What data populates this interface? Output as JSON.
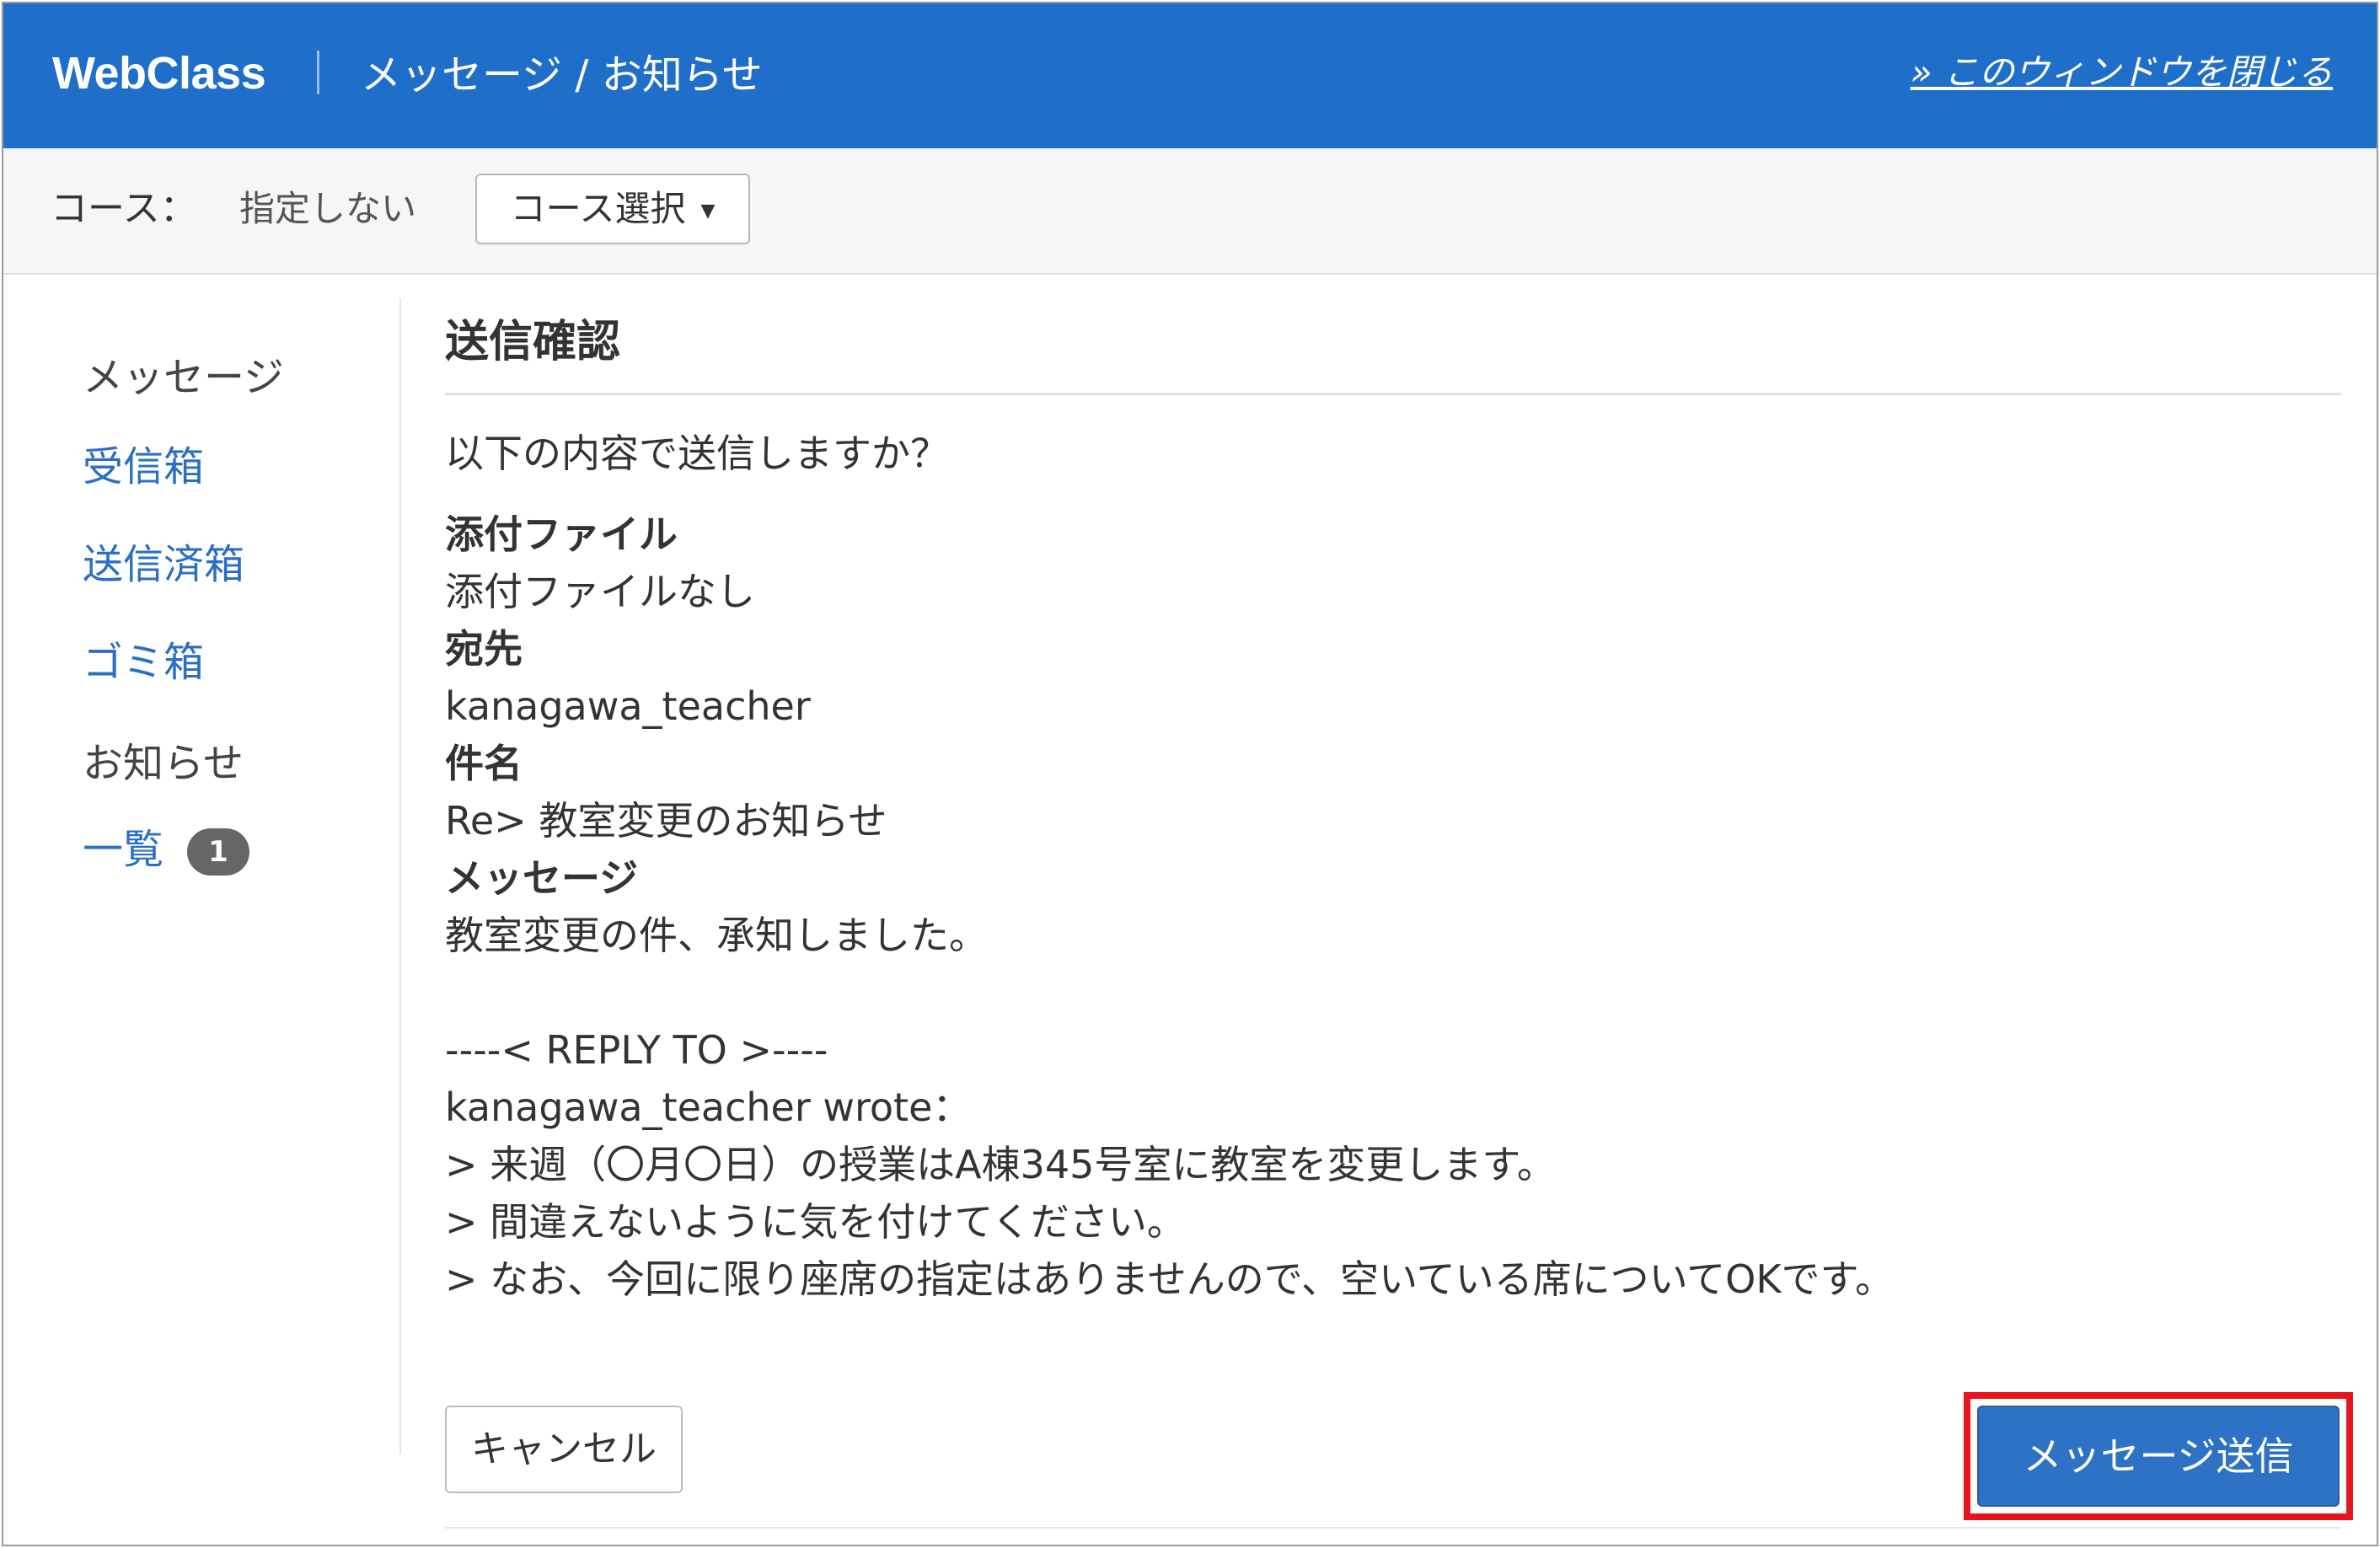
{
  "header": {
    "brand": "WebClass",
    "title": "メッセージ / お知らせ",
    "close_link": "» このウィンドウを閉じる"
  },
  "course_bar": {
    "label": "コース：",
    "value": "指定しない",
    "select_label": "コース選択"
  },
  "sidebar": {
    "message_heading": "メッセージ",
    "inbox": "受信箱",
    "sent": "送信済箱",
    "trash": "ゴミ箱",
    "notice_heading": "お知らせ",
    "notice_list": "一覧",
    "notice_badge": "1"
  },
  "main": {
    "title": "送信確認",
    "prompt": "以下の内容で送信しますか？",
    "attachment_label": "添付ファイル",
    "attachment_value": "添付ファイルなし",
    "to_label": "宛先",
    "to_value": "kanagawa_teacher",
    "subject_label": "件名",
    "subject_value": "Re> 教室変更のお知らせ",
    "message_label": "メッセージ",
    "message_lines": [
      "教室変更の件、承知しました。",
      "",
      "----< REPLY TO >----",
      "kanagawa_teacher wrote：",
      "> 来週（〇月〇日）の授業はA棟345号室に教室を変更します。",
      "> 間違えないように気を付けてください。",
      "> なお、今回に限り座席の指定はありませんので、空いている席についてOKです。"
    ]
  },
  "buttons": {
    "cancel": "キャンセル",
    "send": "メッセージ送信"
  },
  "colors": {
    "header_bg": "#1f6fca",
    "link": "#2a6fc4",
    "send_button": "#2d72c4",
    "highlight": "#e8141b"
  }
}
